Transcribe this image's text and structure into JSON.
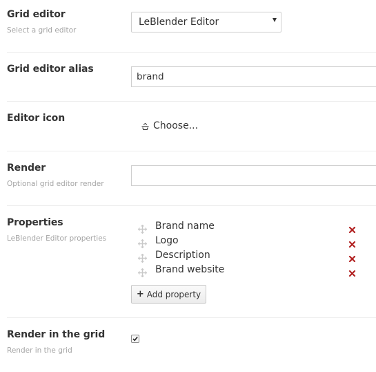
{
  "fields": {
    "grid_editor": {
      "label": "Grid editor",
      "description": "Select a grid editor",
      "selected": "LeBlender Editor"
    },
    "alias": {
      "label": "Grid editor alias",
      "value": "brand"
    },
    "icon": {
      "label": "Editor icon",
      "choose_label": "Choose...",
      "icon_name": "choose-icon"
    },
    "render": {
      "label": "Render",
      "description": "Optional grid editor render",
      "value": ""
    },
    "properties": {
      "label": "Properties",
      "description": "LeBlender Editor properties",
      "items": [
        {
          "name": "Brand name"
        },
        {
          "name": "Logo"
        },
        {
          "name": "Description"
        },
        {
          "name": "Brand website"
        }
      ],
      "add_label": "Add property"
    },
    "render_in_grid": {
      "label": "Render in the grid",
      "description": "Render in the grid",
      "checked": true
    }
  },
  "colors": {
    "text": "#343434",
    "muted": "#a4a4a4",
    "remove": "#b22222",
    "border": "#cfcfcf",
    "divider": "#ececec"
  }
}
